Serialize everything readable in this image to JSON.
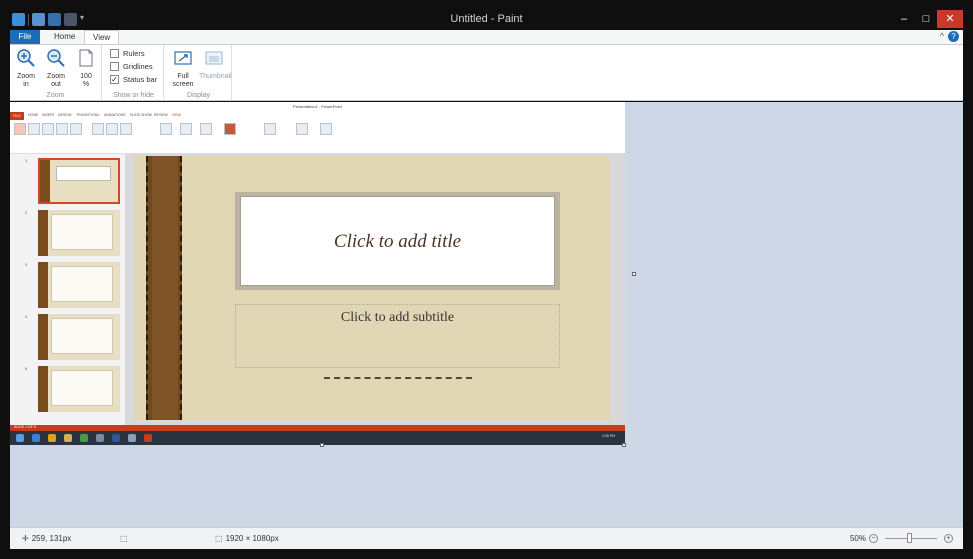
{
  "window": {
    "title": "Untitled - Paint"
  },
  "ribbon": {
    "tabs": [
      "File",
      "Home",
      "View"
    ],
    "active_tab": "View",
    "zoom_group": {
      "label": "Zoom",
      "zoom_in_line1": "Zoom",
      "zoom_in_line2": "in",
      "zoom_out_line1": "Zoom",
      "zoom_out_line2": "out",
      "hundred_line1": "100",
      "hundred_line2": "%"
    },
    "show_hide_group": {
      "label": "Show or hide",
      "rulers": "Rulers",
      "gridlines": "Gridlines",
      "status_bar": "Status bar",
      "rulers_checked": false,
      "gridlines_checked": false,
      "status_bar_checked": true
    },
    "display_group": {
      "label": "Display",
      "full_screen_line1": "Full",
      "full_screen_line2": "screen",
      "thumbnail": "Thumbnail"
    }
  },
  "embedded_image": {
    "app_title": "Presentation1 - PowerPoint",
    "tabs": [
      "FILE",
      "HOME",
      "INSERT",
      "DESIGN",
      "TRANSITIONS",
      "ANIMATIONS",
      "SLIDE SHOW",
      "REVIEW",
      "VIEW"
    ],
    "slide_numbers": [
      "1",
      "2",
      "3",
      "4",
      "5"
    ],
    "slide_title_placeholder": "Click to add title",
    "slide_subtitle_placeholder": "Click to add subtitle",
    "status_text": "SLIDE 1 OF 5",
    "clock": "4:28 PM"
  },
  "statusbar": {
    "cursor_position": "259, 131px",
    "canvas_size": "1920 × 1080px",
    "zoom_level": "50%"
  },
  "colors": {
    "paint_accent": "#1e6bb8",
    "canvas_background": "#cdd7e6",
    "powerpoint_accent": "#c43e1c",
    "close_button": "#c73a2a"
  }
}
